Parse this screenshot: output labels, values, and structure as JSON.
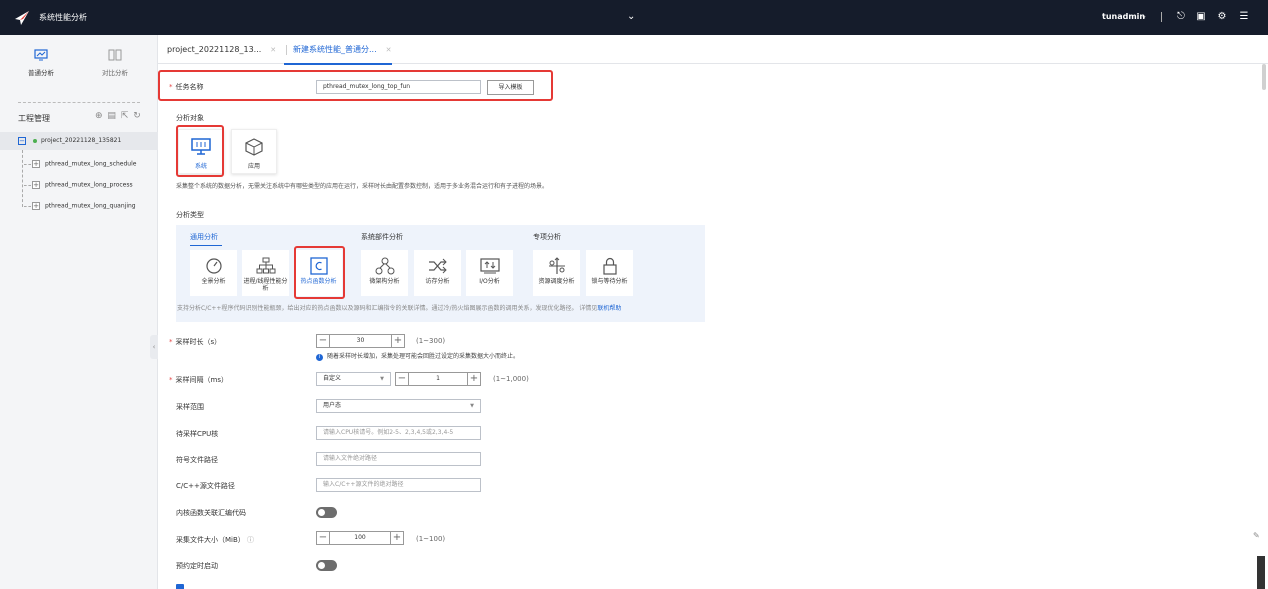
{
  "header": {
    "app_title": "系统性能分析",
    "user": "tunadmin",
    "icons": [
      "logo-icon",
      "chevron-down-icon",
      "logout-icon",
      "document-icon",
      "gear-icon",
      "menu-icon"
    ]
  },
  "sidebar": {
    "modes": [
      {
        "label": "普通分析",
        "icon": "chart-icon",
        "active": true
      },
      {
        "label": "对比分析",
        "icon": "compare-icon",
        "active": false
      }
    ],
    "project_title": "工程管理",
    "project_root": "project_20221128_135821",
    "tasks": [
      "pthread_mutex_long_schedule",
      "pthread_mutex_long_process",
      "pthread_mutex_long_quanjing"
    ]
  },
  "tabs": [
    {
      "label": "project_20221128_13...",
      "active": false
    },
    {
      "label": "新建系统性能_普通分...",
      "active": true
    }
  ],
  "form": {
    "task_name_label": "任务名称",
    "task_name_value": "pthread_mutex_long_top_fun",
    "import_template_label": "导入模板",
    "target_label": "分析对象",
    "targets": [
      {
        "label": "系统",
        "icon": "monitor-icon",
        "selected": true
      },
      {
        "label": "应用",
        "icon": "cube-icon",
        "selected": false
      }
    ],
    "target_desc": "采集整个系统的数据分析，无需关注系统中有哪些类型的应用在运行，采样时长由配置参数控制，适用于多业务混合运行和有子进程的场景。",
    "type_label": "分析类型",
    "categories": [
      "通用分析",
      "系统部件分析",
      "专项分析"
    ],
    "types": [
      {
        "label": "全景分析",
        "icon": "gauge-icon"
      },
      {
        "label": "进程/线程性能分析",
        "icon": "hierarchy-icon"
      },
      {
        "label": "热点函数分析",
        "icon": "c-code-icon"
      },
      {
        "label": "微架构分析",
        "icon": "nodes-icon"
      },
      {
        "label": "访存分析",
        "icon": "shuffle-icon"
      },
      {
        "label": "I/O分析",
        "icon": "io-icon"
      },
      {
        "label": "资源调度分析",
        "icon": "schedule-icon"
      },
      {
        "label": "锁与等待分析",
        "icon": "lock-icon"
      }
    ],
    "type_desc": "支持分析C/C++程序代码识别性能瓶颈，给出对应的热点函数以及源码和汇编指令的关联详情。通过冷/热火焰图展示函数的调用关系，发现优化路径。 详情见",
    "type_desc_link": "联机帮助",
    "duration_label": "采样时长（s）",
    "duration_value": "30",
    "duration_range": "(1~300)",
    "duration_note": "随着采样时长增加，采集处理可能会回胜过设定的采集数据大小而终止。",
    "interval_label": "采样间隔（ms）",
    "interval_mode": "自定义",
    "interval_value": "1",
    "interval_range": "(1~1,000)",
    "scope_label": "采样范围",
    "scope_value": "用户态",
    "cpu_label": "待采样CPU核",
    "cpu_placeholder": "请输入CPU核请号。例如2-5、2,3,4,5或2,3,4-5",
    "symbol_label": "符号文件路径",
    "symbol_placeholder": "请输入文件绝对路径",
    "source_label": "C/C++源文件路径",
    "source_placeholder": "输入C/C++源文件的绝对路径",
    "kernel_label": "内核函数关联汇编代码",
    "filesize_label": "采集文件大小（MiB）",
    "filesize_value": "100",
    "filesize_range": "(1~100)",
    "schedule_label": "预约定时启动",
    "colors": {
      "accent": "#1f66d4",
      "header_bg": "#151c2b",
      "highlight": "#e53935",
      "required": "#e54545"
    }
  }
}
